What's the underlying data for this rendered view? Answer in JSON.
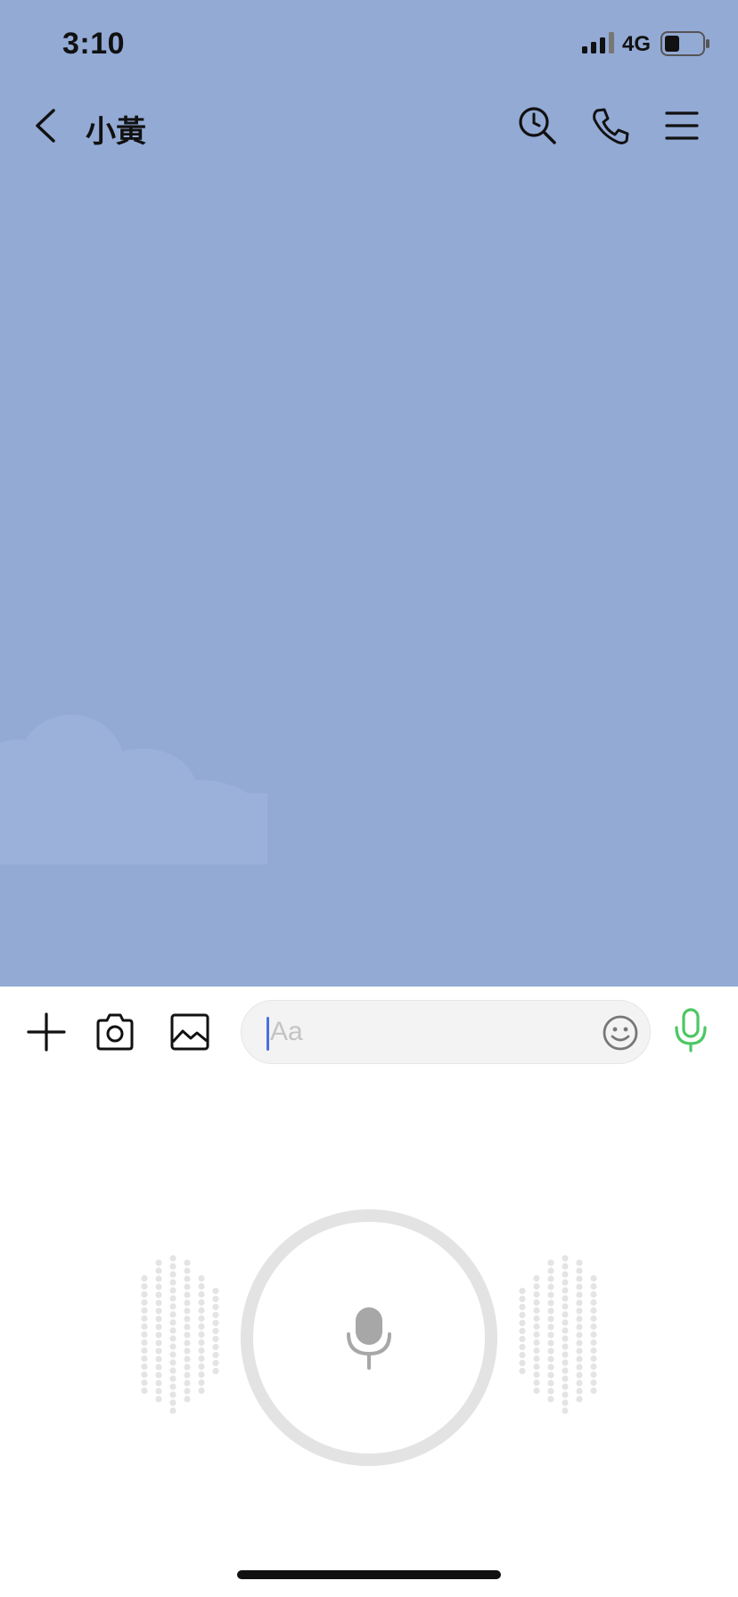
{
  "status_bar": {
    "time": "3:10",
    "network": "4G",
    "signal_icon": "cellular-signal-icon",
    "battery_icon": "battery-icon",
    "battery_level": 0.35
  },
  "header": {
    "title": "小黃",
    "back_icon": "chevron-left-icon",
    "actions": [
      "history-search-icon",
      "phone-call-icon",
      "menu-icon"
    ]
  },
  "chat": {
    "background_color": "#93aad5"
  },
  "toolbar": {
    "buttons": [
      "plus-icon",
      "camera-icon",
      "image-icon"
    ],
    "input_placeholder": "Aa",
    "input_value": "",
    "emoji_icon": "smiley-icon",
    "mic_icon": "microphone-icon",
    "mic_color": "#4cc764"
  },
  "voice_panel": {
    "record_button_icon": "microphone-icon"
  }
}
